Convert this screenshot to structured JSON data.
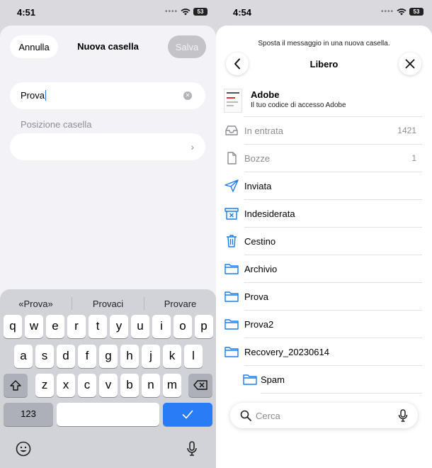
{
  "left": {
    "status": {
      "time": "4:51",
      "battery": "53"
    },
    "header": {
      "cancel": "Annulla",
      "title": "Nuova casella",
      "save": "Salva"
    },
    "name_field": {
      "value": "Prova"
    },
    "position_label": "Posizione casella",
    "keyboard": {
      "suggestions": [
        "«Prova»",
        "Provaci",
        "Provare"
      ],
      "row1": [
        "q",
        "w",
        "e",
        "r",
        "t",
        "y",
        "u",
        "i",
        "o",
        "p"
      ],
      "row2": [
        "a",
        "s",
        "d",
        "f",
        "g",
        "h",
        "j",
        "k",
        "l"
      ],
      "row3": [
        "z",
        "x",
        "c",
        "v",
        "b",
        "n",
        "m"
      ],
      "numbers": "123",
      "shift_icon": "shift-icon",
      "delete_icon": "backspace-icon",
      "return_icon": "checkmark-icon",
      "emoji_icon": "emoji-icon",
      "mic_icon": "microphone-icon"
    }
  },
  "right": {
    "status": {
      "time": "4:54",
      "battery": "53"
    },
    "subtitle": "Sposta il messaggio in una nuova casella.",
    "title": "Libero",
    "message": {
      "sender": "Adobe",
      "preview": "Il tuo codice di accesso Adobe"
    },
    "folders": [
      {
        "label": "In entrata",
        "count": "1421",
        "icon": "inbox-icon",
        "disabled": true
      },
      {
        "label": "Bozze",
        "count": "1",
        "icon": "draft-icon",
        "disabled": true
      },
      {
        "label": "Inviata",
        "count": "",
        "icon": "sent-icon",
        "disabled": false
      },
      {
        "label": "Indesiderata",
        "count": "",
        "icon": "junk-icon",
        "disabled": false
      },
      {
        "label": "Cestino",
        "count": "",
        "icon": "trash-icon",
        "disabled": false
      },
      {
        "label": "Archivio",
        "count": "",
        "icon": "folder-icon",
        "disabled": false
      },
      {
        "label": "Prova",
        "count": "",
        "icon": "folder-icon",
        "disabled": false
      },
      {
        "label": "Prova2",
        "count": "",
        "icon": "folder-icon",
        "disabled": false
      },
      {
        "label": "Recovery_20230614",
        "count": "",
        "icon": "folder-icon",
        "disabled": false
      },
      {
        "label": "Spam",
        "count": "",
        "icon": "folder-icon",
        "disabled": false,
        "sub": true
      }
    ],
    "search": {
      "placeholder": "Cerca"
    },
    "accent": "#1a7cf0"
  }
}
